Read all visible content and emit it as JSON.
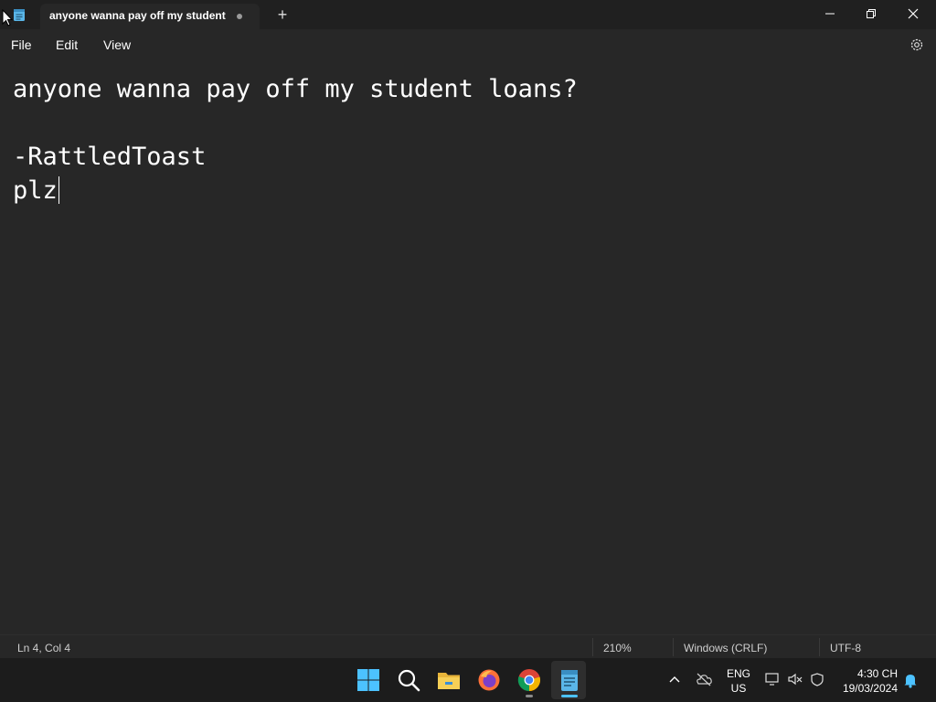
{
  "window": {
    "tab_title": "anyone wanna pay off my student",
    "new_tab": "+"
  },
  "menu": {
    "file": "File",
    "edit": "Edit",
    "view": "View"
  },
  "document": {
    "lines": [
      "anyone wanna pay off my student loans?",
      "",
      "-RattledToast",
      "plz"
    ]
  },
  "status": {
    "position": "Ln 4, Col 4",
    "zoom": "210%",
    "line_ending": "Windows (CRLF)",
    "encoding": "UTF-8"
  },
  "taskbar": {
    "apps": [
      "start-icon",
      "search-icon",
      "file-explorer-icon",
      "firefox-icon",
      "chrome-icon",
      "notepad-icon"
    ],
    "language_line1": "ENG",
    "language_line2": "US",
    "time": "4:30 CH",
    "date": "19/03/2024"
  },
  "colors": {
    "background": "#272727",
    "titlebar": "#202020",
    "taskbar": "#1c1c1c",
    "accent": "#4cc2ff"
  }
}
